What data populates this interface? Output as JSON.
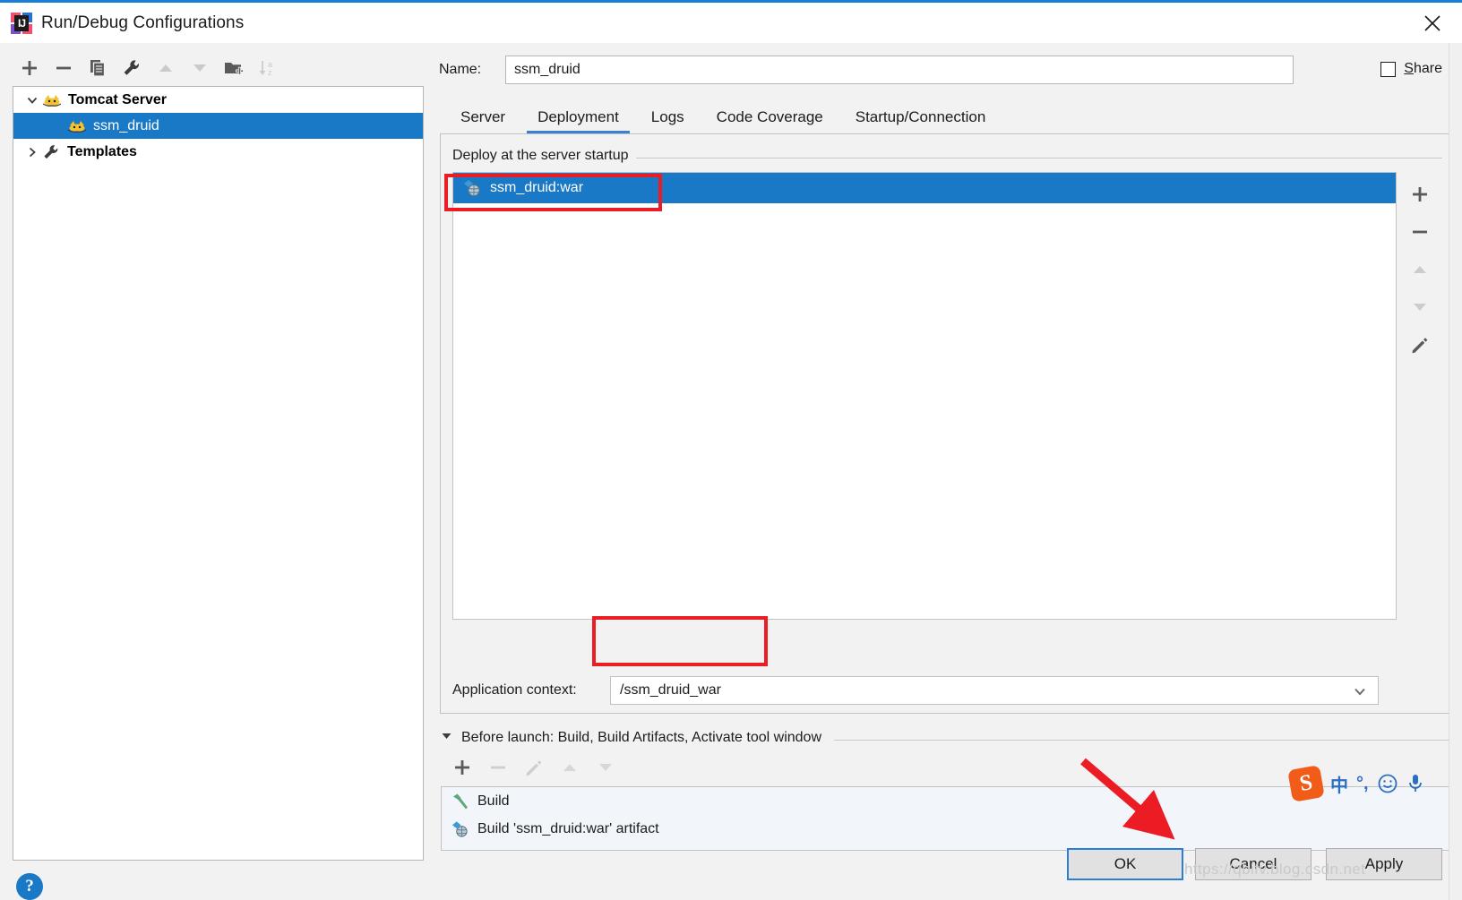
{
  "window": {
    "title": "Run/Debug Configurations",
    "app_icon": "intellij-idea-icon",
    "close_icon": "close-icon"
  },
  "tree_toolbar": {
    "buttons": [
      {
        "name": "add-configuration-button",
        "icon": "plus-icon",
        "enabled": true
      },
      {
        "name": "remove-configuration-button",
        "icon": "minus-icon",
        "enabled": true
      },
      {
        "name": "copy-configuration-button",
        "icon": "copy-icon",
        "enabled": true
      },
      {
        "name": "edit-templates-button",
        "icon": "wrench-icon",
        "enabled": true
      },
      {
        "name": "move-up-button",
        "icon": "arrow-up-icon",
        "enabled": false
      },
      {
        "name": "move-down-button",
        "icon": "arrow-down-icon",
        "enabled": false
      },
      {
        "name": "create-folder-button",
        "icon": "folder-add-icon",
        "enabled": true
      },
      {
        "name": "sort-alphabetically-button",
        "icon": "sort-az-icon",
        "enabled": false
      }
    ]
  },
  "tree": {
    "items": [
      {
        "label": "Tomcat Server",
        "icon": "tomcat-icon",
        "expanded": true,
        "level": 0,
        "selected": false,
        "bold": true
      },
      {
        "label": "ssm_druid",
        "icon": "tomcat-icon",
        "level": 1,
        "selected": true,
        "bold": false
      },
      {
        "label": "Templates",
        "icon": "wrench-icon",
        "expanded": false,
        "level": 0,
        "selected": false,
        "bold": true
      }
    ]
  },
  "help": {
    "label": "?",
    "icon": "help-icon"
  },
  "name_field": {
    "label": "Name:",
    "value": "ssm_druid",
    "placeholder": ""
  },
  "share": {
    "label_prefix": "S",
    "label_rest": "hare",
    "checked": false
  },
  "tabs": [
    {
      "label": "Server",
      "active": false
    },
    {
      "label": "Deployment",
      "active": true
    },
    {
      "label": "Logs",
      "active": false
    },
    {
      "label": "Code Coverage",
      "active": false
    },
    {
      "label": "Startup/Connection",
      "active": false
    }
  ],
  "deployment": {
    "group_title": "Deploy at the server startup",
    "items": [
      {
        "label": "ssm_druid:war",
        "icon": "artifact-icon",
        "selected": true
      }
    ],
    "side_buttons": [
      {
        "name": "add-artifact-button",
        "icon": "plus-icon",
        "enabled": true
      },
      {
        "name": "remove-artifact-button",
        "icon": "minus-icon",
        "enabled": true
      },
      {
        "name": "move-artifact-up-button",
        "icon": "arrow-up-icon",
        "enabled": false
      },
      {
        "name": "move-artifact-down-button",
        "icon": "arrow-down-icon",
        "enabled": false
      },
      {
        "name": "edit-artifact-button",
        "icon": "pencil-icon",
        "enabled": true
      }
    ],
    "application_context": {
      "label": "Application context:",
      "value": "/ssm_druid_war",
      "dropdown_icon": "chevron-down-icon"
    }
  },
  "before_launch": {
    "title": "Before launch: Build, Build Artifacts, Activate tool window",
    "collapse_icon": "triangle-down-icon",
    "toolbar": [
      {
        "name": "add-task-button",
        "icon": "plus-icon",
        "enabled": true
      },
      {
        "name": "remove-task-button",
        "icon": "minus-icon",
        "enabled": false
      },
      {
        "name": "edit-task-button",
        "icon": "pencil-icon",
        "enabled": false
      },
      {
        "name": "task-move-up-button",
        "icon": "arrow-up-icon",
        "enabled": false
      },
      {
        "name": "task-move-down-button",
        "icon": "arrow-down-icon",
        "enabled": false
      }
    ],
    "tasks": [
      {
        "label": "Build",
        "icon": "hammer-icon"
      },
      {
        "label": "Build 'ssm_druid:war' artifact",
        "icon": "artifact-icon"
      }
    ]
  },
  "footer": {
    "ok": "OK",
    "cancel": "Cancel",
    "apply": "Apply"
  },
  "ime": {
    "logo": "sogou-logo-icon",
    "items": [
      {
        "name": "ime-chinese-mode",
        "glyph": "中"
      },
      {
        "name": "ime-punctuation-mode",
        "glyph": "°,"
      },
      {
        "name": "ime-emoji-button",
        "glyph": "☺"
      },
      {
        "name": "ime-voice-button",
        "glyph": "Ἲ4"
      }
    ]
  },
  "watermark": "https://qbifv.blog.csdn.net",
  "annotations": {
    "deploy_highlight": "red-rectangle-deploy-item",
    "context_highlight": "red-rectangle-application-context",
    "ok_arrow": "red-arrow-pointing-to-ok"
  },
  "colors": {
    "accent": "#1a79c7",
    "tab_underline": "#3c7fd0",
    "annotation_red": "#ec1c24",
    "title_border": "#1a7fd4",
    "panel_bg": "#f2f2f2"
  }
}
